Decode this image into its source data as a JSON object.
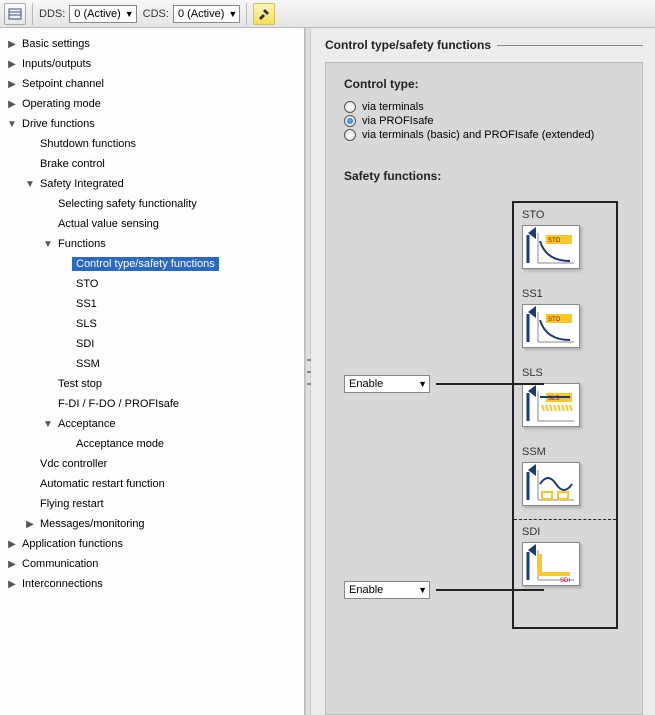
{
  "toolbar": {
    "dds_label": "DDS:",
    "dds_value": "0 (Active)",
    "cds_label": "CDS:",
    "cds_value": "0 (Active)"
  },
  "tree": [
    {
      "depth": 0,
      "toggle": "right",
      "label": "Basic settings"
    },
    {
      "depth": 0,
      "toggle": "right",
      "label": "Inputs/outputs"
    },
    {
      "depth": 0,
      "toggle": "right",
      "label": "Setpoint channel"
    },
    {
      "depth": 0,
      "toggle": "right",
      "label": "Operating mode"
    },
    {
      "depth": 0,
      "toggle": "down",
      "label": "Drive functions"
    },
    {
      "depth": 1,
      "toggle": "",
      "label": "Shutdown functions"
    },
    {
      "depth": 1,
      "toggle": "",
      "label": "Brake control"
    },
    {
      "depth": 1,
      "toggle": "down",
      "label": "Safety Integrated"
    },
    {
      "depth": 2,
      "toggle": "",
      "label": "Selecting safety functionality"
    },
    {
      "depth": 2,
      "toggle": "",
      "label": "Actual value sensing"
    },
    {
      "depth": 2,
      "toggle": "down",
      "label": "Functions"
    },
    {
      "depth": 3,
      "toggle": "",
      "label": "Control type/safety functions",
      "selected": true
    },
    {
      "depth": 3,
      "toggle": "",
      "label": "STO"
    },
    {
      "depth": 3,
      "toggle": "",
      "label": "SS1"
    },
    {
      "depth": 3,
      "toggle": "",
      "label": "SLS"
    },
    {
      "depth": 3,
      "toggle": "",
      "label": "SDI"
    },
    {
      "depth": 3,
      "toggle": "",
      "label": "SSM"
    },
    {
      "depth": 2,
      "toggle": "",
      "label": "Test stop"
    },
    {
      "depth": 2,
      "toggle": "",
      "label": "F-DI / F-DO / PROFIsafe"
    },
    {
      "depth": 2,
      "toggle": "down",
      "label": "Acceptance"
    },
    {
      "depth": 3,
      "toggle": "",
      "label": "Acceptance mode"
    },
    {
      "depth": 1,
      "toggle": "",
      "label": "Vdc controller"
    },
    {
      "depth": 1,
      "toggle": "",
      "label": "Automatic restart function"
    },
    {
      "depth": 1,
      "toggle": "",
      "label": "Flying restart"
    },
    {
      "depth": 1,
      "toggle": "right",
      "label": "Messages/monitoring"
    },
    {
      "depth": 0,
      "toggle": "right",
      "label": "Application functions"
    },
    {
      "depth": 0,
      "toggle": "right",
      "label": "Communication"
    },
    {
      "depth": 0,
      "toggle": "right",
      "label": "Interconnections"
    }
  ],
  "right": {
    "title": "Control type/safety functions",
    "control_type_heading": "Control type:",
    "radios": [
      {
        "label": "via terminals",
        "checked": false
      },
      {
        "label": "via PROFIsafe",
        "checked": true
      },
      {
        "label": "via terminals (basic) and PROFIsafe (extended)",
        "checked": false
      }
    ],
    "safety_heading": "Safety functions:",
    "enable_label": "Enable",
    "sf_items": [
      {
        "label": "STO",
        "tag": "STO"
      },
      {
        "label": "SS1",
        "tag": "STO"
      },
      {
        "label": "SLS",
        "tag": "SLS"
      },
      {
        "label": "SSM",
        "tag": ""
      },
      {
        "label": "SDI",
        "tag": "SDI",
        "dashed": true
      }
    ]
  }
}
